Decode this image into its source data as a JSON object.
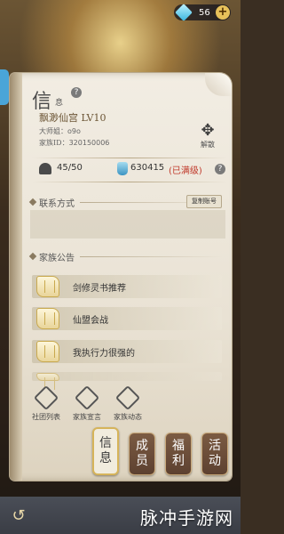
{
  "currency": {
    "icon": "gem-icon",
    "value": "56",
    "add_label": "+"
  },
  "panel": {
    "title": "信",
    "title_sub": "息",
    "help_label": "?",
    "family_name": "飘渺仙宫 LV10",
    "leader_label": "大师姐：",
    "leader_value": "o9o",
    "family_id_label": "家族ID：",
    "family_id_value": "320150006",
    "dissolve_glyph": "✥",
    "dissolve_label": "解散",
    "members": "45/50",
    "funds": "630415",
    "funds_status": "(已满级)",
    "stats_help": "?"
  },
  "contact": {
    "title": "联系方式",
    "copy_label": "复制账号"
  },
  "notices": {
    "title": "家族公告",
    "items": [
      {
        "text": "剑修灵书推荐"
      },
      {
        "text": "仙盟会战"
      },
      {
        "text": "我执行力很强的"
      }
    ]
  },
  "actions": [
    {
      "label": "社团列表"
    },
    {
      "label": "家族宣言"
    },
    {
      "label": "家族动态"
    }
  ],
  "tabs": [
    {
      "label": "信息",
      "active": true
    },
    {
      "label": "成员",
      "active": false
    },
    {
      "label": "福利",
      "active": false
    },
    {
      "label": "活动",
      "active": false
    }
  ],
  "bottom": {
    "back_icon": "↺",
    "watermark": "脉冲手游网"
  },
  "colors": {
    "accent": "#d6b45a",
    "status_red": "#c0392b",
    "tab_brown": "#6b4c38",
    "paper": "#f2ede3"
  }
}
